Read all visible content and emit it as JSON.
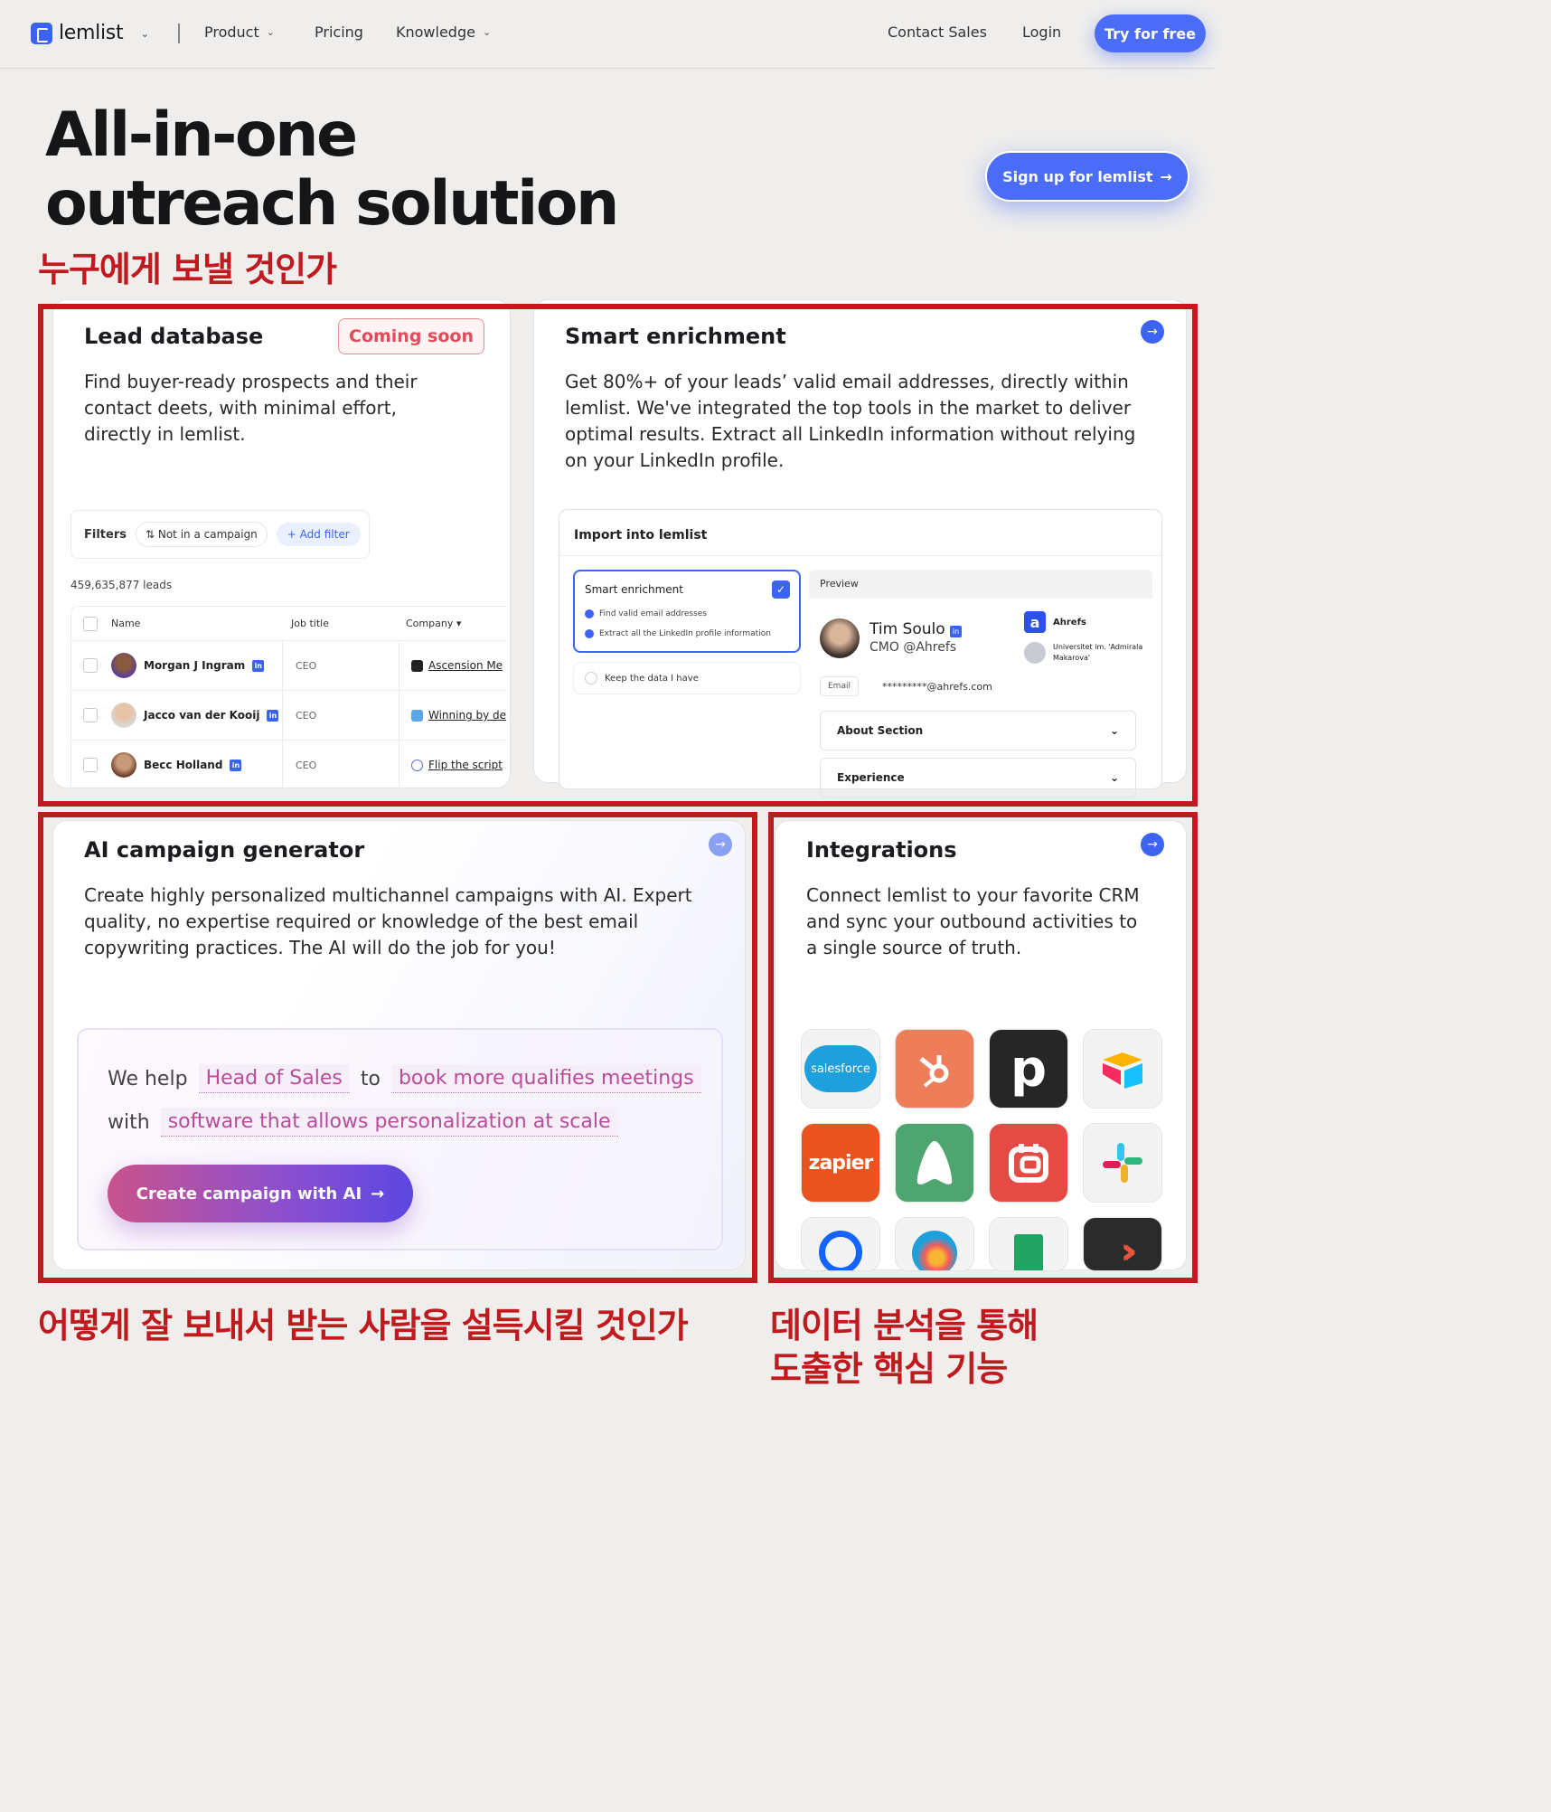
{
  "nav": {
    "logo": "lemlist",
    "links": [
      {
        "label": "Product",
        "chevron": true
      },
      {
        "label": "Pricing",
        "chevron": false
      },
      {
        "label": "Knowledge",
        "chevron": true
      }
    ],
    "contact": "Contact Sales",
    "login": "Login",
    "try": "Try for free"
  },
  "hero": {
    "title_line1": "All-in-one",
    "title_line2": "outreach solution",
    "cta": "Sign up for lemlist"
  },
  "annotations": {
    "who": "누구에게 보낼 것인가",
    "how": "어떻게 잘 보내서 받는 사람을 설득시킬 것인가",
    "data_line1": "데이터 분석을 통해",
    "data_line2": "도출한 핵심 기능",
    "accent": "#c0191e"
  },
  "lead_db": {
    "title": "Lead database",
    "badge": "Coming soon",
    "desc_line1": "Find buyer-ready prospects and their",
    "desc_line2": "contact deets, with minimal effort,",
    "desc_line3": "directly in lemlist.",
    "filters_label": "Filters",
    "filter_chip": "Not in a campaign",
    "add_filter": "Add filter",
    "count": "459,635,877 leads",
    "columns": [
      "Name",
      "Job title",
      "Company"
    ],
    "rows": [
      {
        "name": "Morgan J Ingram",
        "job": "CEO",
        "company": "Ascension Me"
      },
      {
        "name": "Jacco van der Kooij",
        "job": "CEO",
        "company": "Winning by de"
      },
      {
        "name": "Becc Holland",
        "job": "CEO",
        "company": "Flip the script"
      }
    ]
  },
  "enrichment": {
    "title": "Smart enrichment",
    "desc_line1": "Get 80%+ of your leads’ valid email addresses, directly within",
    "desc_line2": "lemlist. We've integrated the top tools in the market to deliver",
    "desc_line3": "optimal results. Extract all LinkedIn information without relying",
    "desc_line4": "on your LinkedIn profile.",
    "import_title": "Import into lemlist",
    "option_title": "Smart enrichment",
    "option_item1": "Find valid email addresses",
    "option_item2": "Extract all the LinkedIn profile information",
    "keep": "Keep the data I have",
    "preview": "Preview",
    "person_name": "Tim Soulo",
    "person_role": "CMO @Ahrefs",
    "company": "Ahrefs",
    "university": "Universitet im. 'Admirala Makarova'",
    "email_label": "Email",
    "email_value": "*********@ahrefs.com",
    "section1": "About Section",
    "section2": "Experience"
  },
  "ai": {
    "title": "AI campaign generator",
    "desc_line1": "Create highly personalized multichannel campaigns with AI. Expert",
    "desc_line2": "quality, no expertise required or knowledge of the best email",
    "desc_line3": "copywriting practices. The AI will do the job for you!",
    "we_help": "We help",
    "role": "Head of Sales",
    "to": "to",
    "goal": "book more qualifies meetings",
    "with": "with",
    "product": "software that allows personalization at scale",
    "cta": "Create campaign with AI"
  },
  "integrations": {
    "title": "Integrations",
    "desc_line1": "Connect lemlist to your favorite CRM",
    "desc_line2": "and sync your outbound activities to",
    "desc_line3": "a single source of truth.",
    "salesforce": "salesforce",
    "zapier": "zapier",
    "pipedrive": "p"
  }
}
